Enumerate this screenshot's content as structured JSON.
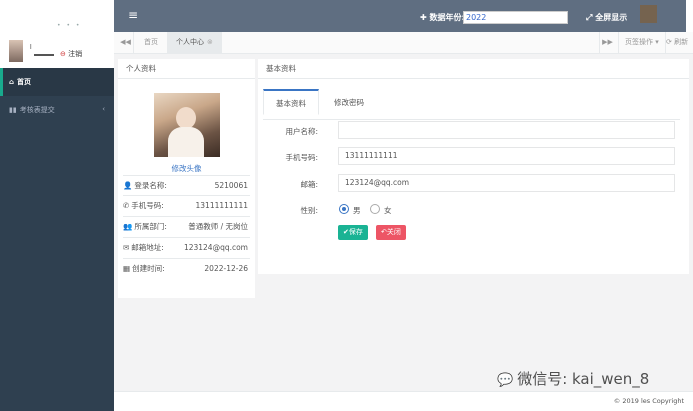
{
  "sidebar": {
    "logo_dots": "• • •",
    "user_name": "l",
    "logout_label": "注销",
    "items": [
      {
        "icon": "home-icon",
        "label": "首页"
      },
      {
        "icon": "chart-icon",
        "label": "考核表提交"
      }
    ]
  },
  "topbar": {
    "menu_icon": "menu-icon",
    "year_label": "数据年份:",
    "year_value": "2022",
    "fullscreen_label": "全屏显示"
  },
  "tabs": {
    "items": [
      {
        "label": "首页",
        "active": false
      },
      {
        "label": "个人中心",
        "active": true
      }
    ],
    "ops_label": "页签操作",
    "refresh_label": "刷新"
  },
  "profile_panel": {
    "title": "个人资料",
    "change_avatar": "修改头像",
    "rows": [
      {
        "icon": "user-icon",
        "label": "登录名称:",
        "value": "5210061"
      },
      {
        "icon": "phone-icon",
        "label": "手机号码:",
        "value": "13111111111"
      },
      {
        "icon": "group-icon",
        "label": "所属部门:",
        "value": "普通教师 / 无岗位"
      },
      {
        "icon": "mail-icon",
        "label": "邮箱地址:",
        "value": "123124@qq.com"
      },
      {
        "icon": "calendar-icon",
        "label": "创建时间:",
        "value": "2022-12-26"
      }
    ]
  },
  "basic_panel": {
    "title": "基本资料",
    "tab_basic": "基本资料",
    "tab_password": "修改密码",
    "fields": {
      "username_label": "用户名称:",
      "username_value": "",
      "phone_label": "手机号码:",
      "phone_value": "13111111111",
      "email_label": "邮箱:",
      "email_value": "123124@qq.com",
      "gender_label": "性别:",
      "male_label": "男",
      "female_label": "女"
    },
    "save_label": "保存",
    "close_label": "关闭"
  },
  "footer": {
    "copyright": "© 2019 les Copyright"
  },
  "watermark": {
    "text": "微信号: kai_wen_8"
  }
}
